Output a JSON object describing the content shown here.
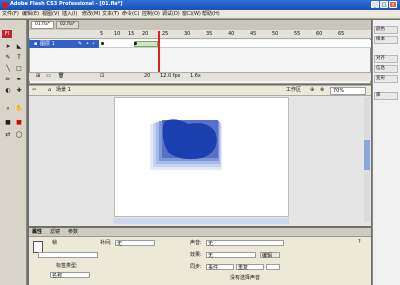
{
  "window": {
    "title": "Adobe Flash CS3 Professional - [01.fla*]",
    "controls": [
      "_",
      "□",
      "×"
    ]
  },
  "menu": [
    "文件(F)",
    "编辑(E)",
    "视图(V)",
    "插入(I)",
    "修改(M)",
    "文本(T)",
    "命令(C)",
    "控制(O)",
    "调试(D)",
    "窗口(W)",
    "帮助(H)"
  ],
  "tools": [
    "➤",
    "◣",
    "✎",
    "T",
    "╲",
    "□",
    "✏",
    "✒",
    "◐",
    "✚",
    "⌕",
    "✋",
    "■",
    "■",
    "⇄",
    "◯"
  ],
  "tools_label": "Fl",
  "doc_tabs": [
    "01.fla*",
    "02.fla*"
  ],
  "timeline": {
    "layer_name": "图层 1",
    "ruler": [
      "5",
      "10",
      "15",
      "20",
      "25",
      "30",
      "35",
      "40",
      "45",
      "50",
      "55",
      "60",
      "65"
    ],
    "frame": "20",
    "fps": "12.0 fps",
    "time": "1.6s"
  },
  "editbar": {
    "scene": "场景 1",
    "workspace": "工作区",
    "zoom": "70%"
  },
  "props": {
    "tabs": [
      "属性",
      "滤镜",
      "参数"
    ],
    "frame_label": "帧",
    "tween_label": "补间:",
    "tween_value": "无",
    "label_type_label": "标签类型:",
    "label_type_value": "名称",
    "sound_label": "声音:",
    "sound_value": "无",
    "effect_label": "效果:",
    "effect_value": "无",
    "edit_button": "编辑",
    "sync_label": "同步:",
    "sync_value": "事件",
    "repeat_value": "重复",
    "no_sound": "没有选择声音"
  },
  "right_panel": [
    "颜色",
    "样本",
    "对齐",
    "信息",
    "变形",
    "库"
  ],
  "colors": {
    "titlebar": "#2f6fd8",
    "shape_fill": "#1c3fb0",
    "playhead": "#e0201a"
  }
}
